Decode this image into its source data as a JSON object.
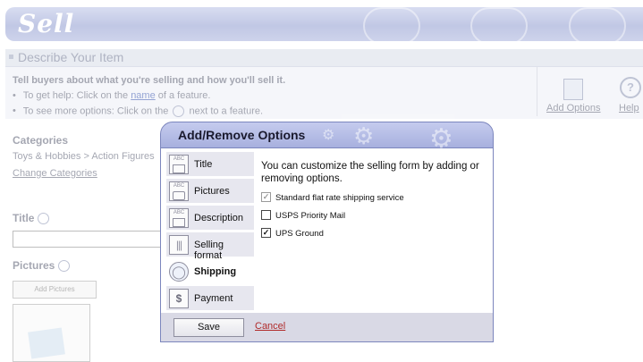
{
  "page": {
    "banner_title": "Sell",
    "section_heading": "Describe Your Item",
    "info_title": "Tell buyers about what you're selling and how you'll sell it.",
    "info_items": [
      {
        "prefix": "To get help: Click on the ",
        "link": "name",
        "suffix": " of a feature."
      },
      {
        "prefix": "To see more options: Click on the ",
        "suffix": " next to a feature."
      }
    ],
    "add_options_label": "Add Options",
    "help_label": "Help",
    "categories_label": "Categories",
    "categories_value": "Toys & Hobbies > Action Figures",
    "change_categories_link": "Change Categories",
    "title_label": "Title",
    "pictures_label": "Pictures",
    "add_pictures_button": "Add Pictures"
  },
  "dialog": {
    "title": "Add/Remove Options",
    "tabs": [
      {
        "label": "Title",
        "icon": "title-abc-icon"
      },
      {
        "label": "Pictures",
        "icon": "camera-icon"
      },
      {
        "label": "Description",
        "icon": "description-abc-icon"
      },
      {
        "label": "Selling format",
        "icon": "barcode-icon"
      },
      {
        "label": "Shipping",
        "icon": "globe-icon",
        "active": true
      },
      {
        "label": "Payment",
        "icon": "dollar-icon"
      }
    ],
    "intro": "You can customize the selling form by adding or removing options.",
    "options": [
      {
        "label": "Standard flat rate shipping service",
        "checked": true,
        "disabled": true
      },
      {
        "label": "USPS Priority Mail",
        "checked": false,
        "disabled": false
      },
      {
        "label": "UPS Ground",
        "checked": true,
        "disabled": false
      }
    ],
    "save_label": "Save",
    "cancel_label": "Cancel"
  },
  "colors": {
    "accent": "#a7b0de",
    "link": "#3a57b0",
    "cancel": "#b02a2a"
  }
}
